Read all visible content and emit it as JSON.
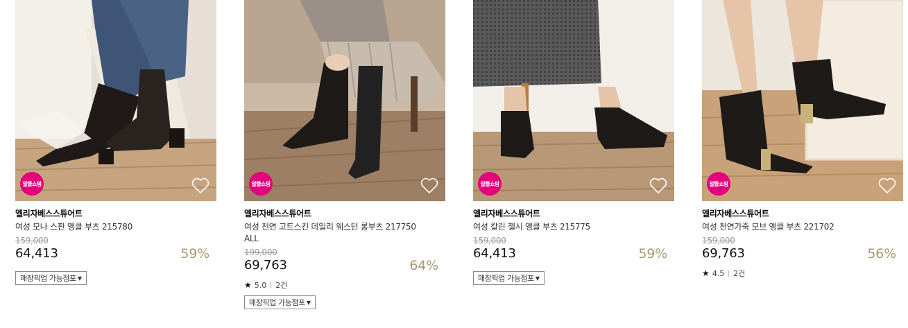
{
  "products": [
    {
      "badge": "알뜰쇼핑",
      "brand": "엘리자베스스튜어트",
      "name": "여성 모나 스판 앵클 부츠 215780",
      "original_price": "159,000",
      "price": "64,413",
      "discount": "59%",
      "pickup_label": "매장픽업 가능점포",
      "image": "black-stretch-ankle-boots"
    },
    {
      "badge": "알뜰쇼핑",
      "brand": "엘리자베스스튜어트",
      "name": "여성 천연 고트스킨 데일리 웨스턴 롱부츠 217750 ALL",
      "original_price": "199,000",
      "price": "69,763",
      "discount": "64%",
      "rating": "5.0",
      "reviews": "2건",
      "pickup_label": "매장픽업 가능점포",
      "image": "black-long-boots"
    },
    {
      "badge": "알뜰쇼핑",
      "brand": "엘리자베스스튜어트",
      "name": "여성 칼린 첼시 앵클 부츠 215775",
      "original_price": "159,000",
      "price": "64,413",
      "discount": "59%",
      "pickup_label": "매장픽업 가능점포",
      "image": "black-chelsea-boots"
    },
    {
      "badge": "알뜰쇼핑",
      "brand": "엘리자베스스튜어트",
      "name": "여성 천연가죽 모브 앵클 부츠 221702",
      "original_price": "159,000",
      "price": "69,763",
      "discount": "56%",
      "rating": "4.5",
      "reviews": "2건",
      "image": "black-ankle-boots-gold-heel"
    }
  ],
  "colors": {
    "badge": "#e3007d",
    "discount": "#a89871"
  }
}
